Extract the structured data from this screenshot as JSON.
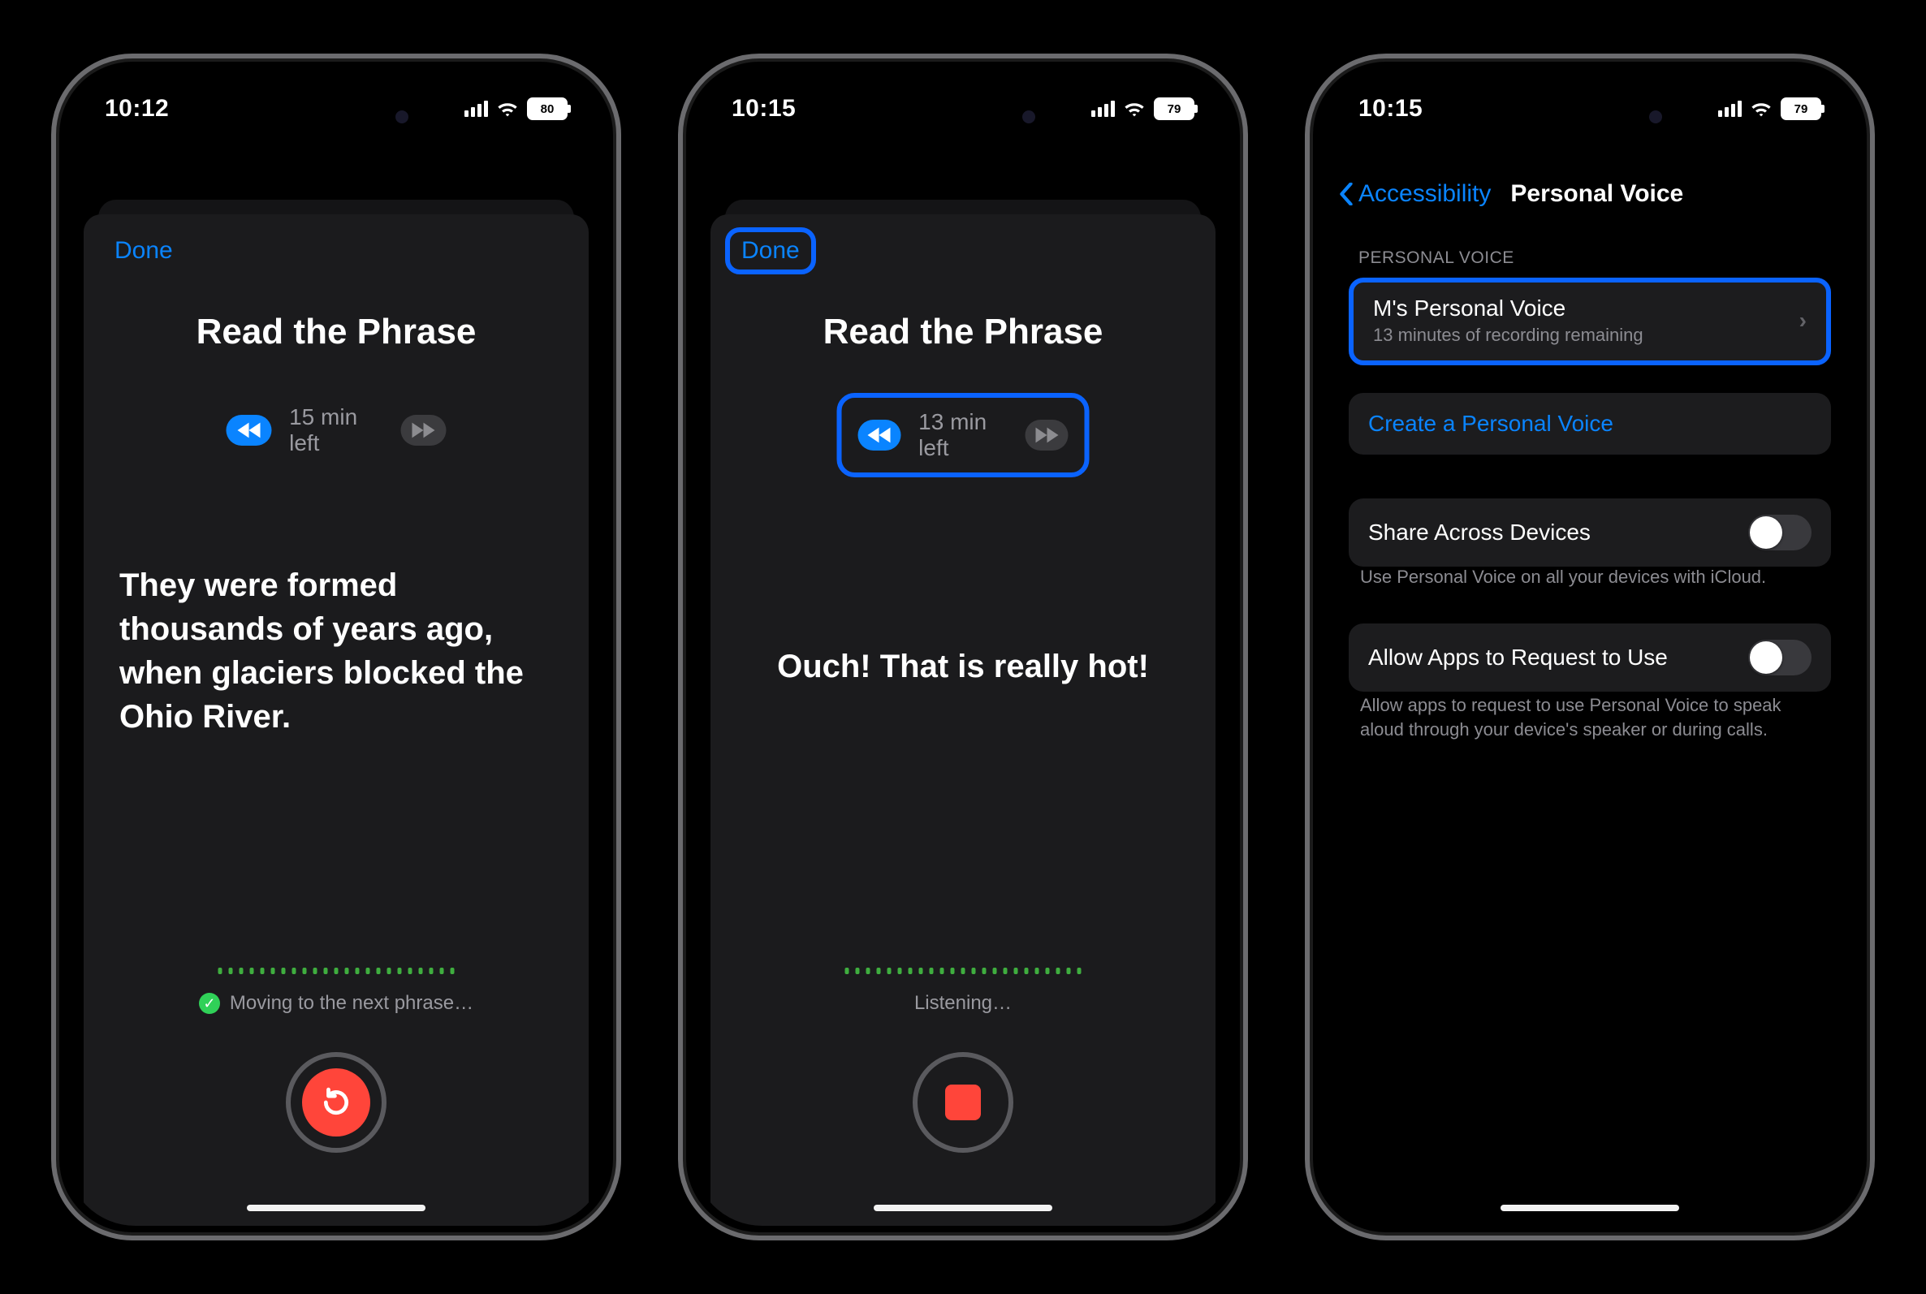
{
  "screens": [
    {
      "statusbar": {
        "time": "10:12",
        "battery": "80"
      },
      "done_label": "Done",
      "title": "Read the Phrase",
      "time_left": "15 min left",
      "phrase": "They were formed thousands of years ago, when glaciers blocked the Ohio River.",
      "status_line": "Moving to the next phrase…",
      "record_button_mode": "retry"
    },
    {
      "statusbar": {
        "time": "10:15",
        "battery": "79"
      },
      "done_label": "Done",
      "title": "Read the Phrase",
      "time_left": "13 min left",
      "phrase": "Ouch! That is really hot!",
      "status_line": "Listening…",
      "record_button_mode": "stop"
    },
    {
      "statusbar": {
        "time": "10:15",
        "battery": "79"
      },
      "nav": {
        "back_label": "Accessibility",
        "title": "Personal Voice"
      },
      "section_header": "PERSONAL VOICE",
      "voice_row": {
        "title": "M's Personal Voice",
        "subtitle": "13 minutes of recording remaining"
      },
      "create_label": "Create a Personal Voice",
      "share_label": "Share Across Devices",
      "share_toggle_on": false,
      "share_footer": "Use Personal Voice on all your devices with iCloud.",
      "allow_label": "Allow Apps to Request to Use",
      "allow_toggle_on": false,
      "allow_footer": "Allow apps to request to use Personal Voice to speak aloud through your device's speaker or during calls."
    }
  ]
}
